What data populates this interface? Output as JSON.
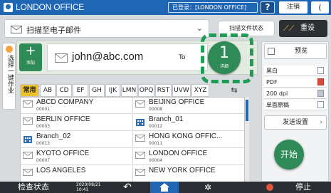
{
  "titlebar": {
    "title": "LONDON OFFICE",
    "login": "已登录：[LONDON OFFICE]",
    "help": "?",
    "logout": "注销",
    "extra": "(",
    "color": "#1f66b5"
  },
  "mode": {
    "label": "扫描至电子邮件",
    "scan_status": "扫描文件状态",
    "reset": "重设"
  },
  "side_tab": {
    "label": "选择一键作业"
  },
  "destination": {
    "add_label": "添加",
    "address": "john@abc.com",
    "to_label": "To",
    "count": "1",
    "detail_label": "详细"
  },
  "index_tabs": [
    "常用",
    "AB",
    "CD",
    "EF",
    "GH",
    "IJK",
    "LMN",
    "OPQ",
    "RST",
    "UVW",
    "XYZ"
  ],
  "index_active": "常用",
  "entries": [
    {
      "name": "ABCD COMPANY",
      "number": "00001",
      "icon": "envelope-icon"
    },
    {
      "name": "BEIJING OFFICE",
      "number": "00008",
      "icon": "envelope-icon"
    },
    {
      "name": "BERLIN OFFICE",
      "number": "00003",
      "icon": "envelope-icon"
    },
    {
      "name": "Branch_01",
      "number": "00012",
      "icon": "building-icon"
    },
    {
      "name": "Branch_02",
      "number": "00013",
      "icon": "building-icon"
    },
    {
      "name": "HONG KONG OFFIC...",
      "number": "00011",
      "icon": "envelope-icon"
    },
    {
      "name": "KYOTO OFFICE",
      "number": "00007",
      "icon": "envelope-icon"
    },
    {
      "name": "LONDON OFFICE",
      "number": "00004",
      "icon": "envelope-icon"
    },
    {
      "name": "LOS ANGELES",
      "number": "",
      "icon": "envelope-icon"
    },
    {
      "name": "NEW YORK OFFICE",
      "number": "",
      "icon": "envelope-icon"
    }
  ],
  "settings_panel": {
    "preview": "预览",
    "items": [
      "黑白",
      "PDF",
      "200 dpi",
      "单面原稿"
    ],
    "send_settings": "发送设置",
    "start": "开始"
  },
  "bottombar": {
    "status": "检查状态",
    "date": "2020/08/21",
    "time": "10:41",
    "stop": "停止"
  }
}
